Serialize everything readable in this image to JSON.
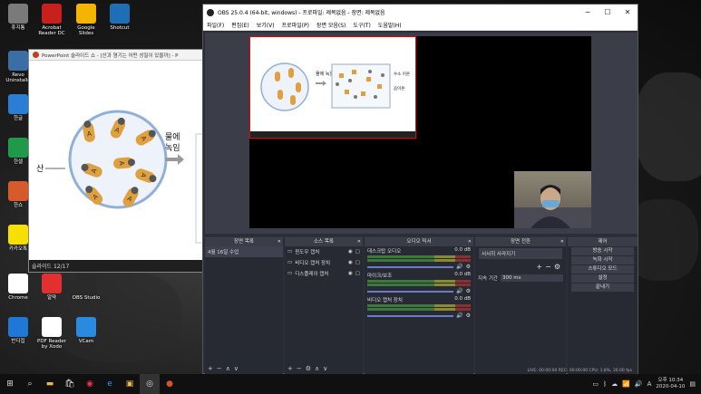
{
  "desktop_icons": [
    {
      "label": "휴지통",
      "icon": "recycle-bin-icon",
      "color": "#7a7a7a"
    },
    {
      "label": "Acrobat Reader DC",
      "icon": "acrobat-icon",
      "color": "#c8201c"
    },
    {
      "label": "Google Slides",
      "icon": "google-slides-icon",
      "color": "#f4b400"
    },
    {
      "label": "Shotcut",
      "icon": "shotcut-icon",
      "color": "#1e6fb5"
    },
    {
      "label": "Revo Uninstalle",
      "icon": "revo-icon",
      "color": "#3a6ea5"
    },
    {
      "label": "한글",
      "icon": "hangul-icon",
      "color": "#2a7fd4"
    },
    {
      "label": "한셀",
      "icon": "hancell-icon",
      "color": "#1e9a4a"
    },
    {
      "label": "한쇼",
      "icon": "hanshow-icon",
      "color": "#d65a2a"
    },
    {
      "label": "카카오톡",
      "icon": "kakaotalk-icon",
      "color": "#f7e000"
    },
    {
      "label": "Chrome",
      "icon": "chrome-icon",
      "color": "#ffffff"
    },
    {
      "label": "알약",
      "icon": "alyac-icon",
      "color": "#e23030"
    },
    {
      "label": "OBS Studio",
      "icon": "obs-icon",
      "color": "#2a2a2a"
    },
    {
      "label": "반디집",
      "icon": "bandizip-icon",
      "color": "#1e78d4"
    },
    {
      "label": "PDF Reader by Xodo",
      "icon": "xodo-icon",
      "color": "#ffffff"
    },
    {
      "label": "VCam",
      "icon": "vcam-icon",
      "color": "#2a8ae0"
    }
  ],
  "ppt": {
    "title": "PowerPoint 슬라이드 쇼 - [산과 염기는 어떤 성질이 있을까] - P",
    "slide_label": "슬라이드 12/17",
    "acid_label": "산",
    "water_label": "물에 녹임"
  },
  "obs": {
    "title": "OBS 25.0.4 (64-bit, windows) - 프로파일: 제목없음 - 장면: 제목없음",
    "menu": [
      "파일(F)",
      "편집(E)",
      "보기(V)",
      "프로파일(P)",
      "장면 모음(S)",
      "도구(T)",
      "도움말(H)"
    ],
    "preview_labels": {
      "water": "물에 녹임",
      "h": "수소 이온",
      "a": "음이온"
    },
    "scenes": {
      "header": "장면 목록",
      "items": [
        "4월 16일 수업"
      ]
    },
    "sources": {
      "header": "소스 목록",
      "items": [
        "윈도우 캡처",
        "비디오 캡처 장치",
        "디스플레이 캡처"
      ]
    },
    "mixer": {
      "header": "오디오 믹서",
      "channels": [
        {
          "name": "데스크탑 오디오",
          "db": "0.0 dB"
        },
        {
          "name": "마이크/보조",
          "db": "0.0 dB"
        },
        {
          "name": "비디오 캡처 장치",
          "db": "0.0 dB"
        }
      ]
    },
    "transitions": {
      "header": "장면 전환",
      "type": "서서히 사라지기",
      "duration_label": "지속 기간",
      "duration": "300 ms"
    },
    "controls": {
      "header": "제어",
      "buttons": [
        "방송 시작",
        "녹화 시작",
        "스튜디오 모드",
        "설정",
        "끝내기"
      ]
    },
    "status": "LIVE: 00:00:00    REC: 00:00:00    CPU: 1.8%, 30.00 fps"
  },
  "taskbar": {
    "time": "오후 10:34",
    "date": "2020-04-10"
  }
}
